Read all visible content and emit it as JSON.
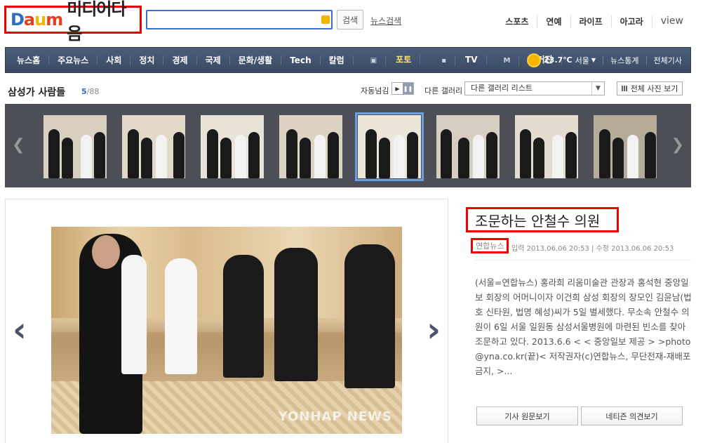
{
  "header": {
    "logo_brand": "Daum",
    "logo_text": "미디어다음",
    "search_value": "",
    "search_button": "검색",
    "news_search": "뉴스검색",
    "top_nav": [
      "스포츠",
      "연예",
      "라이프",
      "아고라",
      "view"
    ]
  },
  "navbar": {
    "items": [
      "뉴스홈",
      "주요뉴스",
      "사회",
      "정치",
      "경제",
      "국제",
      "문화/생활",
      "Tech",
      "칼럼"
    ],
    "photo_label": "포토",
    "tv_label": "TV",
    "magazine_label": "매거진",
    "weather": {
      "temp": "23.7℃",
      "city": "서울"
    },
    "right_links": [
      "뉴스통계",
      "전체기사"
    ]
  },
  "gallery": {
    "title": "삼성가 사람들",
    "current": "5",
    "total": "/88",
    "autoplay_label": "자동넘김",
    "other_gallery_label": "다른 갤러리",
    "select_value": "다른 갤러리 리스트",
    "all_photos_button": "전체 사진 보기",
    "thumbnail_count": 8,
    "selected_index": 5
  },
  "main_photo": {
    "watermark": "YONHAP NEWS"
  },
  "article": {
    "title": "조문하는 안철수 의원",
    "source": "연합뉴스",
    "input_time": "입력 2013.06.06 20:53",
    "edit_time": "수정 2013.06.06 20:53",
    "body": "(서울=연합뉴스) 홍라희 리움미술관 관장과 홍석현 중앙일보 회장의 어머니이자 이건희 삼성 회장의 장모인 김윤남(법호 신타원, 법명 혜성)씨가 5일 별세했다. 무소속 안철수 의원이 6일 서울 일원동 삼성서울병원에 마련된 빈소를 찾아 조문하고 있다. 2013.6.6 < < 중앙일보 제공 > >photo@yna.co.kr(끝)< 저작권자(c)연합뉴스, 무단전재-재배포금지, >...",
    "original_button": "기사 원문보기",
    "comments_button": "네티즌 의견보기"
  },
  "colors": {
    "nav_bg": "#3f506b",
    "highlight_border": "#ee0000",
    "accent_blue": "#2a6ec8"
  }
}
